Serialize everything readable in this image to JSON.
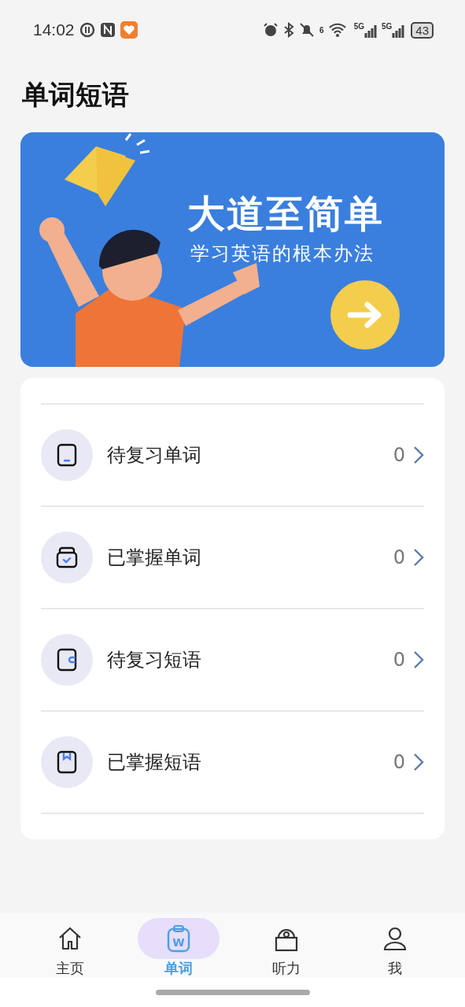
{
  "status_bar": {
    "time": "14:02",
    "wifi_label": "6",
    "network_labels": [
      "5G",
      "5G"
    ],
    "battery": "43"
  },
  "title": "单词短语",
  "banner": {
    "kind": "picture",
    "headline": "大道至简单",
    "subtitle": "学习英语的根本办法"
  },
  "list": [
    {
      "kind": "pending-word",
      "label": "待复习单词",
      "count": "0"
    },
    {
      "kind": "mastered-word",
      "label": "已掌握单词",
      "count": "0"
    },
    {
      "kind": "pending-phrase",
      "label": "待复习短语",
      "count": "0"
    },
    {
      "kind": "mastered-phrase",
      "label": "已掌握短语",
      "count": "0"
    }
  ],
  "tabs": [
    {
      "kind": "home",
      "label": "主页",
      "selected": false
    },
    {
      "kind": "words",
      "label": "单词",
      "selected": true,
      "icon_text": "W"
    },
    {
      "kind": "listening",
      "label": "听力",
      "selected": false
    },
    {
      "kind": "me",
      "label": "我",
      "selected": false
    }
  ]
}
